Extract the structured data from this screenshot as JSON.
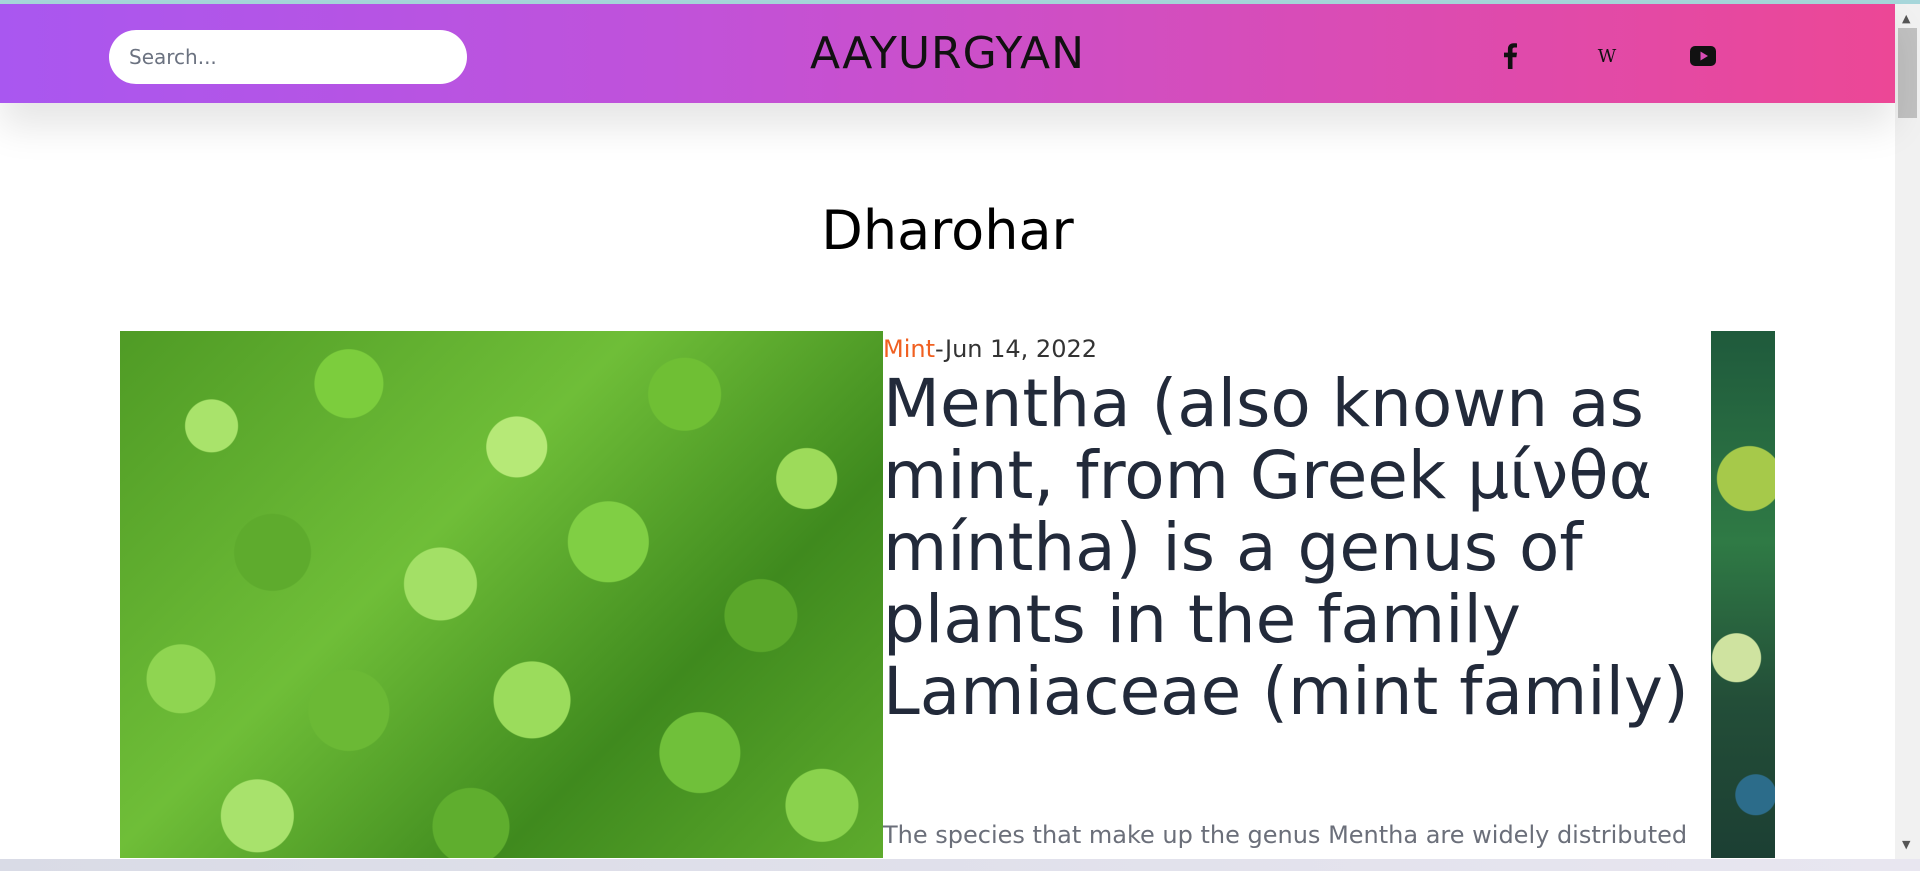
{
  "header": {
    "search_placeholder": "Search...",
    "site_title": "AAYURGYAN",
    "social": [
      {
        "label": "f",
        "icon": "facebook-icon"
      },
      {
        "label": "W",
        "icon": "wikipedia-icon"
      },
      {
        "label": "",
        "icon": "youtube-icon"
      }
    ]
  },
  "main": {
    "heading": "Dharohar",
    "article": {
      "category": "Mint",
      "separator": "-",
      "date": "Jun 14, 2022",
      "title": "Mentha (also known as mint, from Greek μίνθα míntha) is a genus of plants in the family Lamiaceae (mint family)",
      "excerpt": "The species that make up the genus Mentha are widely distributed"
    }
  },
  "colors": {
    "header_gradient_start": "#a957f0",
    "header_gradient_end": "#ec4796",
    "category": "#f06021",
    "title": "#222a3a"
  }
}
